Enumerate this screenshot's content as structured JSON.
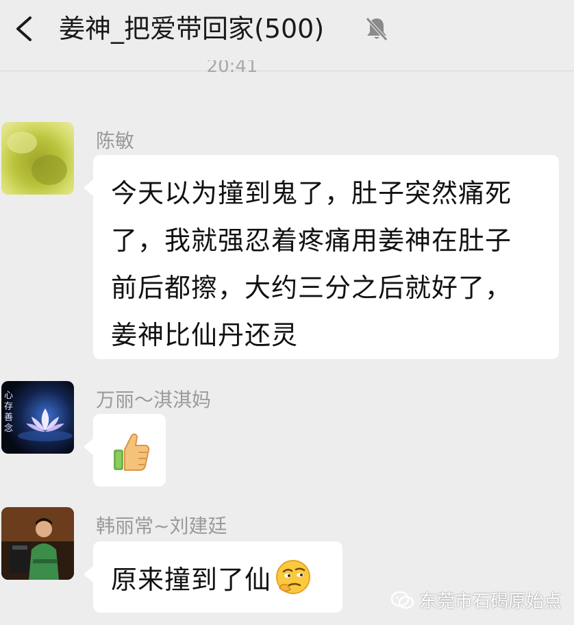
{
  "header": {
    "title": "姜神_把爱带回家(500)",
    "back_icon": "chevron-left-icon",
    "mute_icon": "bell-muted-icon"
  },
  "timestamp": "20:41",
  "messages": [
    {
      "sender": "陈敏",
      "avatar": "green-blur-avatar",
      "lines": [
        "今天以为撞到鬼了，肚子突然痛死",
        "了，我就强忍着疼痛用姜神在肚子",
        "前后都擦，大约三分之后就好了，",
        "姜神比仙丹还灵"
      ]
    },
    {
      "sender": "万丽～淇淇妈",
      "avatar": "lotus-avatar",
      "avatar_text": "心存善念",
      "sticker": "thumbs-up-emoji"
    },
    {
      "sender": "韩丽常~刘建廷",
      "avatar": "man-photo-avatar",
      "text": "原来撞到了仙",
      "emoji": "thinking-face-emoji"
    }
  ],
  "watermark": {
    "text": "东莞市石碣原始点",
    "icon": "wechat-official-icon"
  },
  "colors": {
    "background": "#ededed",
    "bubble": "#ffffff",
    "name_gray": "#9a9a9a"
  }
}
